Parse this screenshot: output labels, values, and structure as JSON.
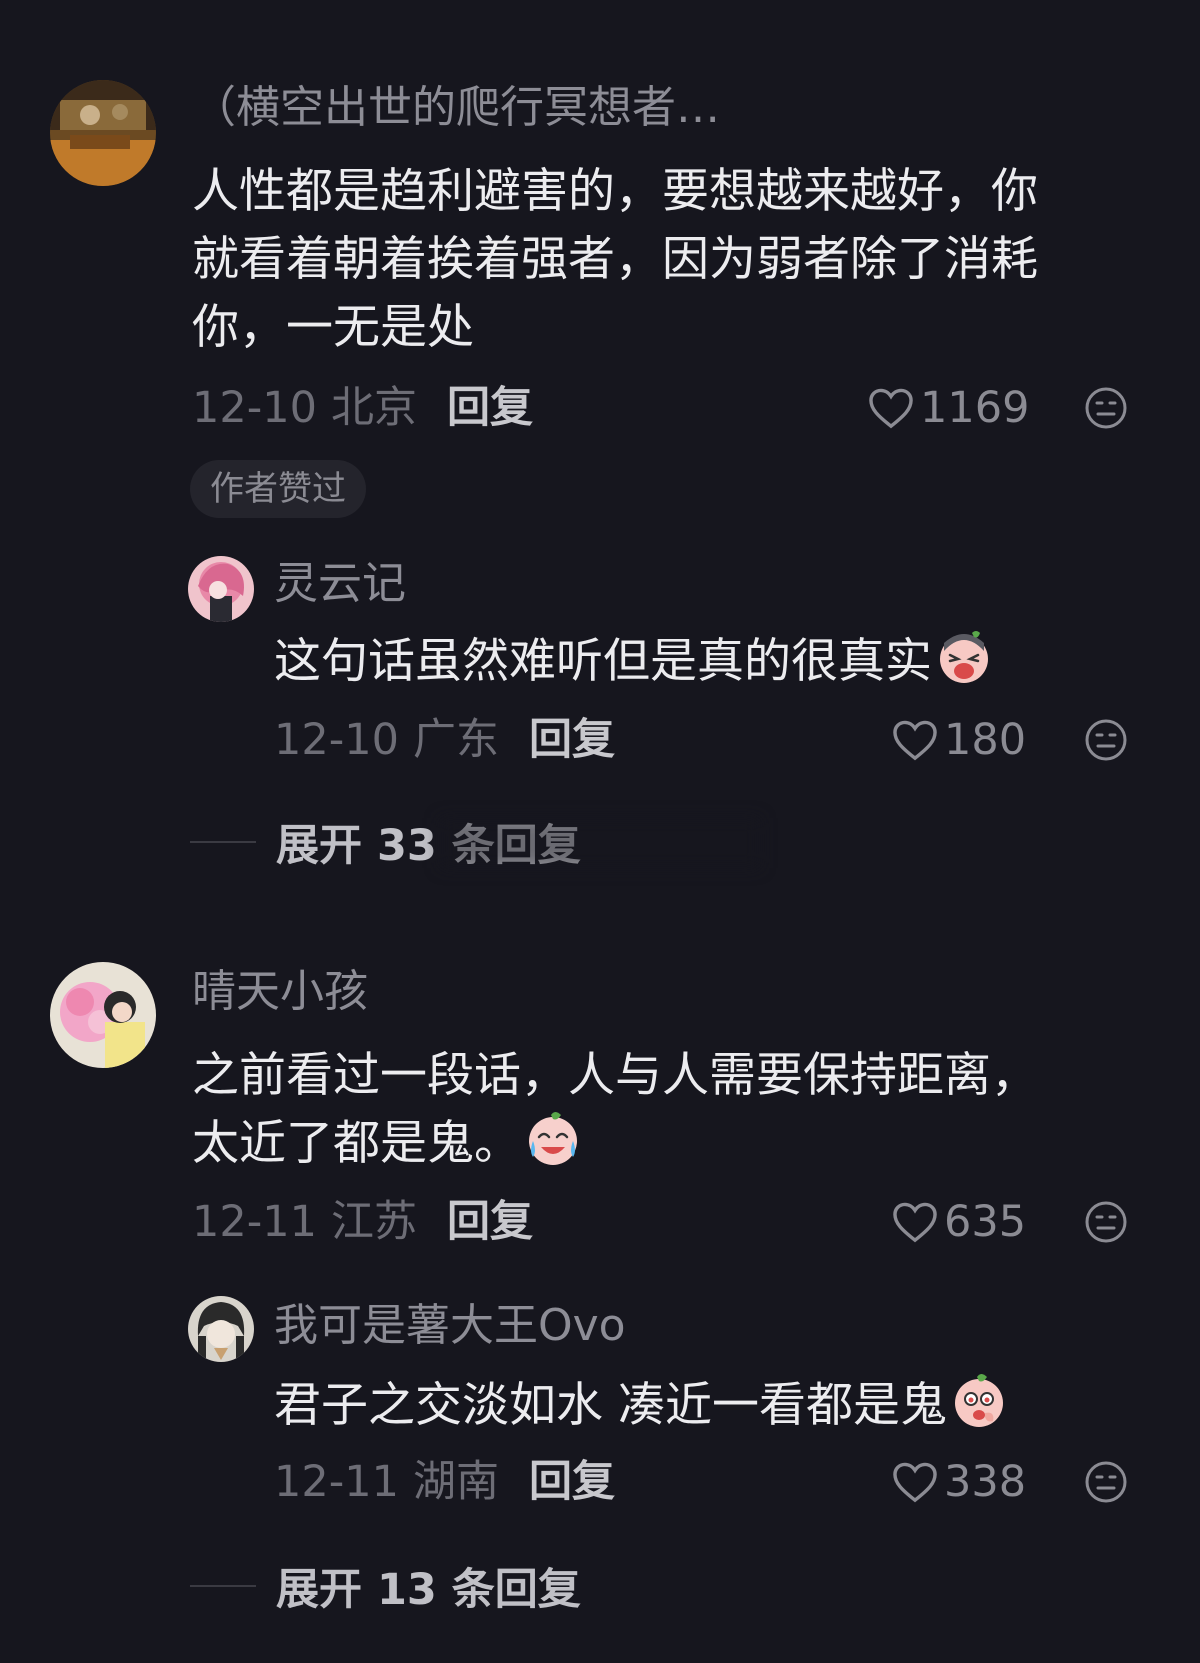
{
  "comments": [
    {
      "username": "（横空出世的爬行冥想者…",
      "content_lines": [
        "人性都是趋利避害的，要想越来越好，你",
        "就看着朝着挨着强者，因为弱者除了消耗",
        "你，一无是处"
      ],
      "date": "12-10",
      "location": "北京",
      "reply_label": "回复",
      "likes": "1169",
      "badge": "作者赞过",
      "reply": {
        "username": "灵云记",
        "content": "这句话虽然难听但是真的很真实",
        "emoji": "crying-face-icon",
        "date": "12-10",
        "location": "广东",
        "reply_label": "回复",
        "likes": "180"
      },
      "expand_label": "展开 33 条回复"
    },
    {
      "username": "晴天小孩",
      "content_lines": [
        "之前看过一段话，人与人需要保持距离，",
        "太近了都是鬼。"
      ],
      "emoji": "laughing-tears-icon",
      "date": "12-11",
      "location": "江苏",
      "reply_label": "回复",
      "likes": "635",
      "reply": {
        "username": "我可是薯大王Ovo",
        "content": "君子之交淡如水 凑近一看都是鬼",
        "emoji": "shy-face-icon",
        "date": "12-11",
        "location": "湖南",
        "reply_label": "回复",
        "likes": "338"
      },
      "expand_label": "展开 13 条回复"
    }
  ],
  "colors": {
    "background": "#16161e",
    "text": "#ececef",
    "muted": "#8d8d96"
  }
}
